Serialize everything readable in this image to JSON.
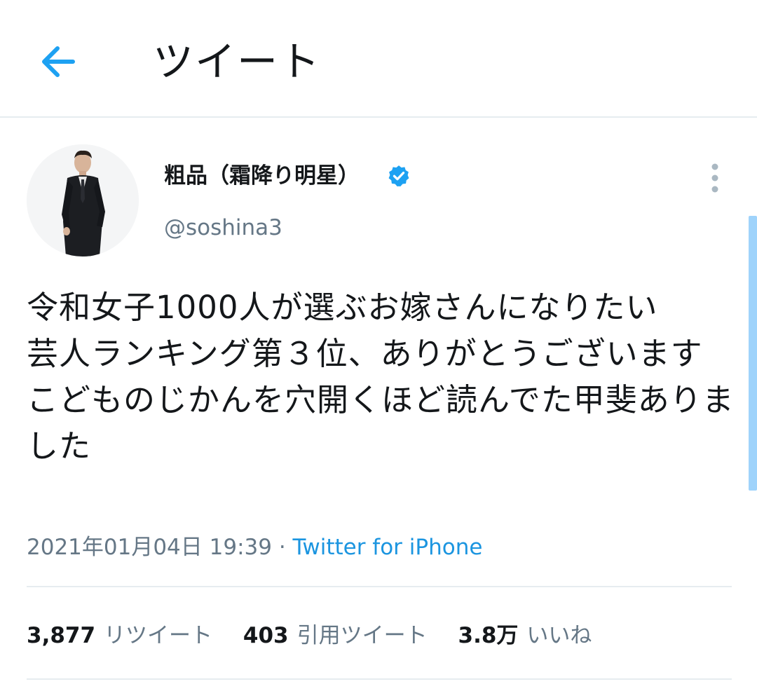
{
  "header": {
    "title": "ツイート",
    "back_icon": "arrow-left-icon"
  },
  "tweet": {
    "author": {
      "display_name": "粗品（霜降り明星）",
      "handle": "@soshina3",
      "verified": true,
      "verified_icon": "verified-badge-icon"
    },
    "text": "令和女子1000人が選ぶお嫁さんになりたい\n芸人ランキング第３位、ありがとうございます\nこどものじかんを穴開くほど読んでた甲斐ありました",
    "timestamp": "2021年01月04日 19:39",
    "separator": " · ",
    "source": "Twitter for iPhone",
    "stats": {
      "retweets": {
        "value": "3,877",
        "label": "リツイート"
      },
      "quotes": {
        "value": "403",
        "label": "引用ツイート"
      },
      "likes": {
        "value": "3.8万",
        "label": "いいね"
      }
    }
  },
  "colors": {
    "accent": "#1da1f2",
    "link": "#1b95e0",
    "secondary_text": "#657786",
    "primary_text": "#14171a",
    "divider": "#e6ecf0",
    "scrollbar": "#9fd3fb"
  }
}
